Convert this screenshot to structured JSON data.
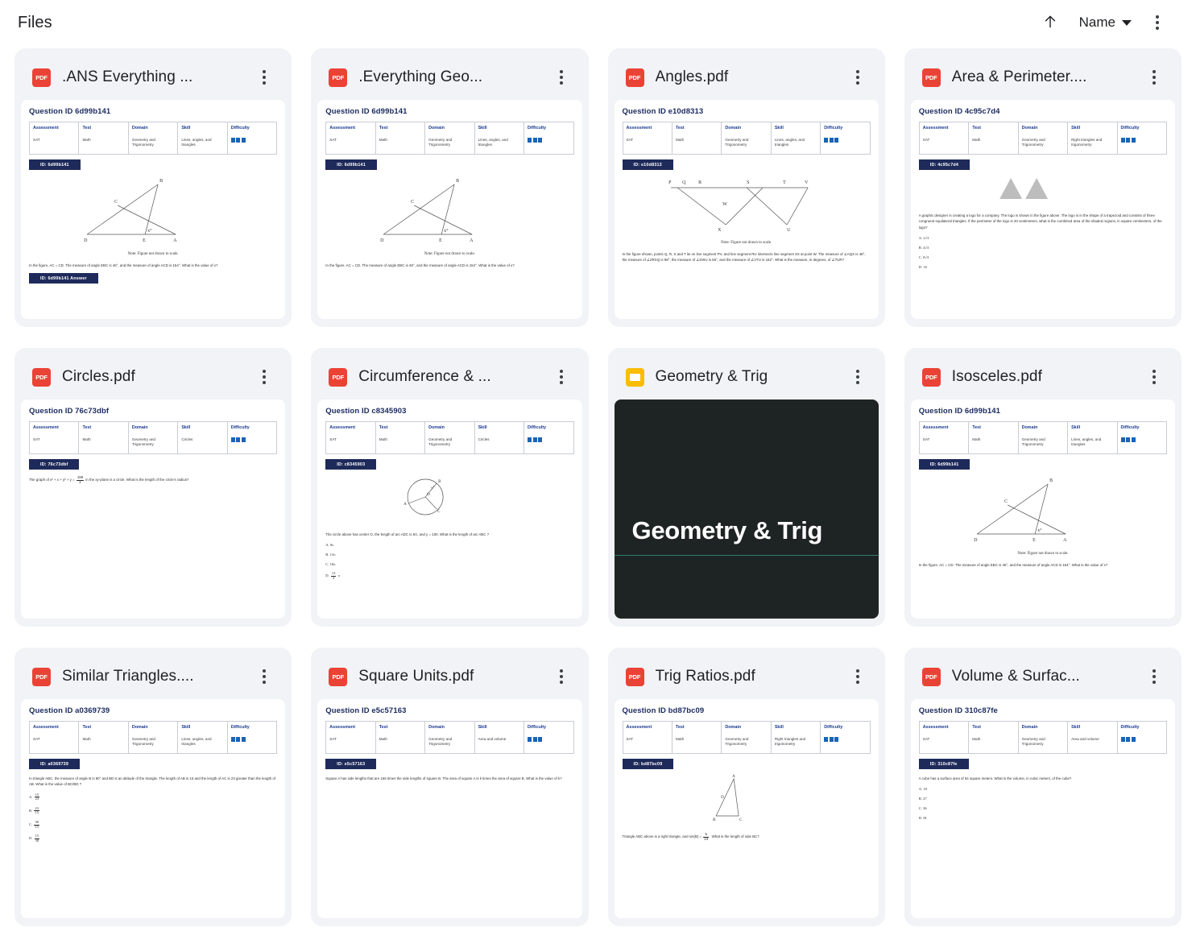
{
  "header": {
    "title": "Files",
    "sort_direction_icon": "arrow-up-icon",
    "sort_label": "Name",
    "sort_caret_icon": "chevron-down-icon",
    "overflow_icon": "more-vert-icon"
  },
  "common": {
    "meta_headers": [
      "Assessment",
      "Test",
      "Domain",
      "Skill",
      "Difficulty"
    ],
    "assessment": "SAT",
    "test": "Math",
    "domain": "Geometry and Trigonometry",
    "note": "Note: Figure not drawn to scale.",
    "difficulty_bars": 3,
    "pdf_icon_label": "PDF",
    "card_menu_icon": "more-vert-icon"
  },
  "colors": {
    "pdf_red": "#ea4335",
    "slides_yellow": "#fbbc04",
    "doc_heading_blue": "#1a2a5e",
    "table_header_blue": "#1a3a8f",
    "chip_navy": "#1e2a5a",
    "difficulty_blue": "#1b63b5",
    "card_bg": "#f1f3f6",
    "slide_bg": "#1e2423",
    "slide_rule": "#2e7d6a"
  },
  "files": [
    {
      "name": ".ANS Everything ...",
      "type": "pdf",
      "question_id_label": "Question ID 6d99b141",
      "id_chip": "ID: 6d99b141",
      "skill": "Lines, angles, and triangles",
      "figure": "triangle-DEA-B-C",
      "note": "Note: Figure not drawn to scale.",
      "question": "In the figure, AC = CD. The measure of angle EBC is 46°, and the measure of angle ACD is 154°. What is the value of x?",
      "answer_chip": "ID: 6d99b141 Answer",
      "choices": []
    },
    {
      "name": ".Everything Geo...",
      "type": "pdf",
      "question_id_label": "Question ID 6d99b141",
      "id_chip": "ID: 6d99b141",
      "skill": "Lines, angles, and triangles",
      "figure": "triangle-DEA-B-C",
      "note": "Note: Figure not drawn to scale.",
      "question": "In the figure, AC = CD. The measure of angle EBC is 46°, and the measure of angle ACD is 154°. What is the value of x?",
      "answer_chip": "",
      "choices": []
    },
    {
      "name": "Angles.pdf",
      "type": "pdf",
      "question_id_label": "Question ID e10d8313",
      "id_chip": "ID: e10d8313",
      "skill": "Lines, angles, and triangles",
      "figure": "transversal-PQRSTV",
      "note": "Note: Figure not drawn to scale.",
      "question": "In the figure shown, points Q, R, S and T lie on line segment PV, and line segment RU intersects line segment SX at point W. The measure of ∠AQX is 48°, the measure of ∠ZRXQ is 98°, the measure of ∠SWU is 65°, and the measure of ∠VTU is 162°. What is the measure, in degrees, of ∠TUR?",
      "answer_chip": "",
      "choices": []
    },
    {
      "name": "Area & Perimeter....",
      "type": "pdf",
      "question_id_label": "Question ID 4c95c7d4",
      "id_chip": "ID: 4c95c7d4",
      "skill": "Right triangles and trigonometry",
      "figure": "two-gray-triangles",
      "note": "",
      "question": "A graphic designer is creating a logo for a company. The logo is shown in the figure above. The logo is in the shape of a trapezoid and consists of three congruent equilateral triangles. If the perimeter of the logo is 20 centimeters, what is the combined area of the shaded regions, in square centimeters, of the logo?",
      "answer_chip": "",
      "choices": [
        "A. 2√3",
        "B. 4√3",
        "C. 8√3",
        "D. 16"
      ]
    },
    {
      "name": "Circles.pdf",
      "type": "pdf",
      "question_id_label": "Question ID 76c73dbf",
      "id_chip": "ID: 76c73dbf",
      "skill": "Circles",
      "figure": "",
      "note": "",
      "question": "The graph of x² + x + y² + y = 199/2 in the xy-plane is a circle. What is the length of the circle's radius?",
      "answer_chip": "",
      "choices": []
    },
    {
      "name": "Circumference & ...",
      "type": "pdf",
      "question_id_label": "Question ID c8345903",
      "id_chip": "ID: c8345903",
      "skill": "Circles",
      "figure": "circle-center-O",
      "note": "",
      "question": "The circle above has center O, the length of arc ADC is 5π, and y = 100. What is the length of arc ABC ?",
      "answer_chip": "",
      "choices": [
        "A. 9π",
        "B. 13π",
        "C. 18π",
        "D. 13/2 π"
      ]
    },
    {
      "name": "Geometry & Trig",
      "type": "slides",
      "slide_title": "Geometry & Trig"
    },
    {
      "name": "Isosceles.pdf",
      "type": "pdf",
      "question_id_label": "Question ID 6d99b141",
      "id_chip": "ID: 6d99b141",
      "skill": "Lines, angles, and triangles",
      "figure": "triangle-DEA-B-C",
      "note": "Note: Figure not drawn to scale.",
      "question": "In the figure, AC = CD. The measure of angle EBC is 46°, and the measure of angle ACD is 154°. What is the value of x?",
      "answer_chip": "",
      "choices": []
    },
    {
      "name": "Similar Triangles....",
      "type": "pdf",
      "question_id_label": "Question ID a0369739",
      "id_chip": "ID: a0369739",
      "skill": "Lines, angles, and triangles",
      "figure": "",
      "note": "",
      "question": "In triangle ABC, the measure of angle B is 90° and BD is an altitude of the triangle. The length of AB is 15 and the length of AC is 23 greater than the length of AB. What is the value of BC/BD ?",
      "answer_chip": "",
      "choices": [
        "A. 15/23",
        "B. 23/15",
        "C. 38/15",
        "D. 15/38"
      ]
    },
    {
      "name": "Square Units.pdf",
      "type": "pdf",
      "question_id_label": "Question ID e5c57163",
      "id_chip": "ID: e5c57163",
      "skill": "Area and volume",
      "figure": "",
      "note": "",
      "question": "Square A has side lengths that are 166 times the side lengths of square B. The area of square A is k times the area of square B. What is the value of k?",
      "answer_chip": "",
      "choices": []
    },
    {
      "name": "Trig Ratios.pdf",
      "type": "pdf",
      "question_id_label": "Question ID bd87bc09",
      "id_chip": "ID: bd87bc09",
      "skill": "Right triangles and trigonometry",
      "figure": "right-triangle-ABC",
      "note": "",
      "question": "Triangle ABC above is a right triangle, and sin(B) = 5/13. What is the length of side BC?",
      "answer_chip": "",
      "choices": []
    },
    {
      "name": "Volume & Surfac...",
      "type": "pdf",
      "question_id_label": "Question ID 310c87fe",
      "id_chip": "ID: 310c87fe",
      "skill": "Area and volume",
      "figure": "",
      "note": "",
      "question": "A cube has a surface area of 54 square meters. What is the volume, in cubic meters, of the cube?",
      "answer_chip": "",
      "choices": [
        "A. 18",
        "B. 27",
        "C. 36",
        "D. 81"
      ]
    }
  ]
}
